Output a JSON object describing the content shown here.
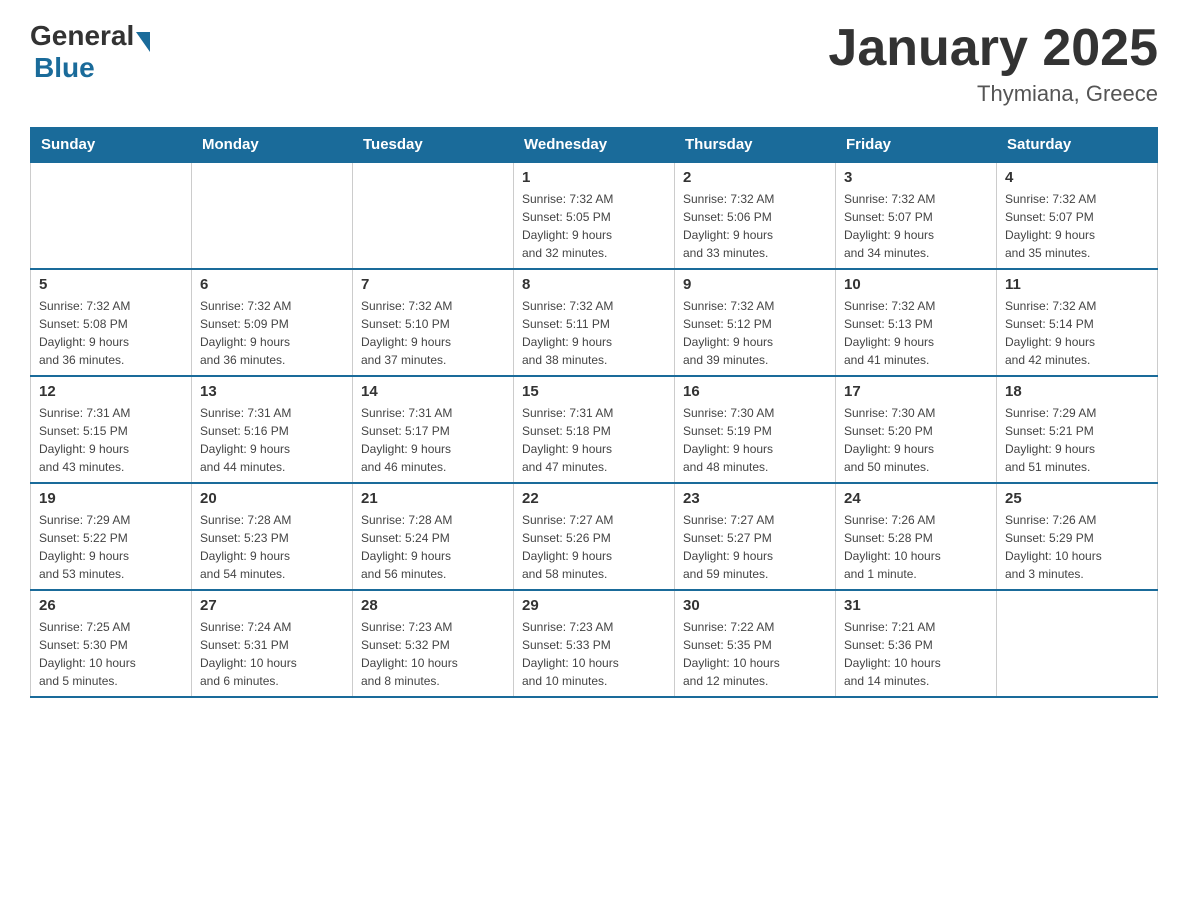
{
  "header": {
    "title": "January 2025",
    "location": "Thymiana, Greece",
    "logo_general": "General",
    "logo_blue": "Blue"
  },
  "days_of_week": [
    "Sunday",
    "Monday",
    "Tuesday",
    "Wednesday",
    "Thursday",
    "Friday",
    "Saturday"
  ],
  "weeks": [
    [
      {
        "day": "",
        "info": ""
      },
      {
        "day": "",
        "info": ""
      },
      {
        "day": "",
        "info": ""
      },
      {
        "day": "1",
        "info": "Sunrise: 7:32 AM\nSunset: 5:05 PM\nDaylight: 9 hours\nand 32 minutes."
      },
      {
        "day": "2",
        "info": "Sunrise: 7:32 AM\nSunset: 5:06 PM\nDaylight: 9 hours\nand 33 minutes."
      },
      {
        "day": "3",
        "info": "Sunrise: 7:32 AM\nSunset: 5:07 PM\nDaylight: 9 hours\nand 34 minutes."
      },
      {
        "day": "4",
        "info": "Sunrise: 7:32 AM\nSunset: 5:07 PM\nDaylight: 9 hours\nand 35 minutes."
      }
    ],
    [
      {
        "day": "5",
        "info": "Sunrise: 7:32 AM\nSunset: 5:08 PM\nDaylight: 9 hours\nand 36 minutes."
      },
      {
        "day": "6",
        "info": "Sunrise: 7:32 AM\nSunset: 5:09 PM\nDaylight: 9 hours\nand 36 minutes."
      },
      {
        "day": "7",
        "info": "Sunrise: 7:32 AM\nSunset: 5:10 PM\nDaylight: 9 hours\nand 37 minutes."
      },
      {
        "day": "8",
        "info": "Sunrise: 7:32 AM\nSunset: 5:11 PM\nDaylight: 9 hours\nand 38 minutes."
      },
      {
        "day": "9",
        "info": "Sunrise: 7:32 AM\nSunset: 5:12 PM\nDaylight: 9 hours\nand 39 minutes."
      },
      {
        "day": "10",
        "info": "Sunrise: 7:32 AM\nSunset: 5:13 PM\nDaylight: 9 hours\nand 41 minutes."
      },
      {
        "day": "11",
        "info": "Sunrise: 7:32 AM\nSunset: 5:14 PM\nDaylight: 9 hours\nand 42 minutes."
      }
    ],
    [
      {
        "day": "12",
        "info": "Sunrise: 7:31 AM\nSunset: 5:15 PM\nDaylight: 9 hours\nand 43 minutes."
      },
      {
        "day": "13",
        "info": "Sunrise: 7:31 AM\nSunset: 5:16 PM\nDaylight: 9 hours\nand 44 minutes."
      },
      {
        "day": "14",
        "info": "Sunrise: 7:31 AM\nSunset: 5:17 PM\nDaylight: 9 hours\nand 46 minutes."
      },
      {
        "day": "15",
        "info": "Sunrise: 7:31 AM\nSunset: 5:18 PM\nDaylight: 9 hours\nand 47 minutes."
      },
      {
        "day": "16",
        "info": "Sunrise: 7:30 AM\nSunset: 5:19 PM\nDaylight: 9 hours\nand 48 minutes."
      },
      {
        "day": "17",
        "info": "Sunrise: 7:30 AM\nSunset: 5:20 PM\nDaylight: 9 hours\nand 50 minutes."
      },
      {
        "day": "18",
        "info": "Sunrise: 7:29 AM\nSunset: 5:21 PM\nDaylight: 9 hours\nand 51 minutes."
      }
    ],
    [
      {
        "day": "19",
        "info": "Sunrise: 7:29 AM\nSunset: 5:22 PM\nDaylight: 9 hours\nand 53 minutes."
      },
      {
        "day": "20",
        "info": "Sunrise: 7:28 AM\nSunset: 5:23 PM\nDaylight: 9 hours\nand 54 minutes."
      },
      {
        "day": "21",
        "info": "Sunrise: 7:28 AM\nSunset: 5:24 PM\nDaylight: 9 hours\nand 56 minutes."
      },
      {
        "day": "22",
        "info": "Sunrise: 7:27 AM\nSunset: 5:26 PM\nDaylight: 9 hours\nand 58 minutes."
      },
      {
        "day": "23",
        "info": "Sunrise: 7:27 AM\nSunset: 5:27 PM\nDaylight: 9 hours\nand 59 minutes."
      },
      {
        "day": "24",
        "info": "Sunrise: 7:26 AM\nSunset: 5:28 PM\nDaylight: 10 hours\nand 1 minute."
      },
      {
        "day": "25",
        "info": "Sunrise: 7:26 AM\nSunset: 5:29 PM\nDaylight: 10 hours\nand 3 minutes."
      }
    ],
    [
      {
        "day": "26",
        "info": "Sunrise: 7:25 AM\nSunset: 5:30 PM\nDaylight: 10 hours\nand 5 minutes."
      },
      {
        "day": "27",
        "info": "Sunrise: 7:24 AM\nSunset: 5:31 PM\nDaylight: 10 hours\nand 6 minutes."
      },
      {
        "day": "28",
        "info": "Sunrise: 7:23 AM\nSunset: 5:32 PM\nDaylight: 10 hours\nand 8 minutes."
      },
      {
        "day": "29",
        "info": "Sunrise: 7:23 AM\nSunset: 5:33 PM\nDaylight: 10 hours\nand 10 minutes."
      },
      {
        "day": "30",
        "info": "Sunrise: 7:22 AM\nSunset: 5:35 PM\nDaylight: 10 hours\nand 12 minutes."
      },
      {
        "day": "31",
        "info": "Sunrise: 7:21 AM\nSunset: 5:36 PM\nDaylight: 10 hours\nand 14 minutes."
      },
      {
        "day": "",
        "info": ""
      }
    ]
  ]
}
